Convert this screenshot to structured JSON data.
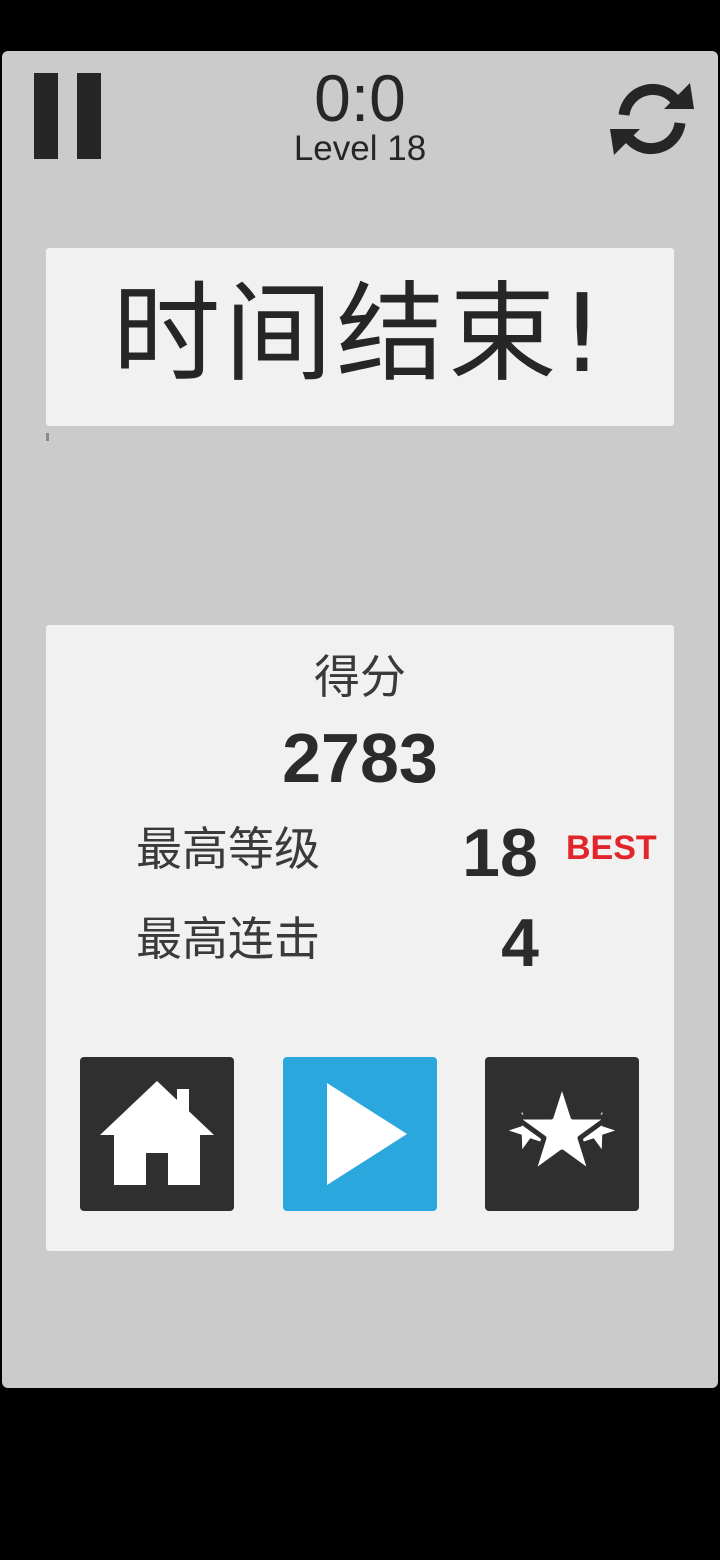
{
  "header": {
    "timer": "0:0",
    "level": "Level 18",
    "pause_icon": "pause-icon",
    "restart_icon": "refresh-icon"
  },
  "banner": {
    "title": "时间结束!"
  },
  "results": {
    "score_label": "得分",
    "score_value": "2783",
    "stats": [
      {
        "label": "最高等级",
        "value": "18",
        "badge": "BEST"
      },
      {
        "label": "最高连击",
        "value": "4"
      }
    ]
  },
  "actions": [
    {
      "name": "home",
      "icon": "home-icon"
    },
    {
      "name": "play",
      "icon": "play-icon"
    },
    {
      "name": "leaderboard",
      "icon": "stars-icon"
    }
  ],
  "colors": {
    "background": "#cbcbcb",
    "card": "#f1f1f1",
    "text": "#262626",
    "best": "#e2252b",
    "play": "#2aa7dd",
    "dark_button": "#2f2f2f"
  }
}
